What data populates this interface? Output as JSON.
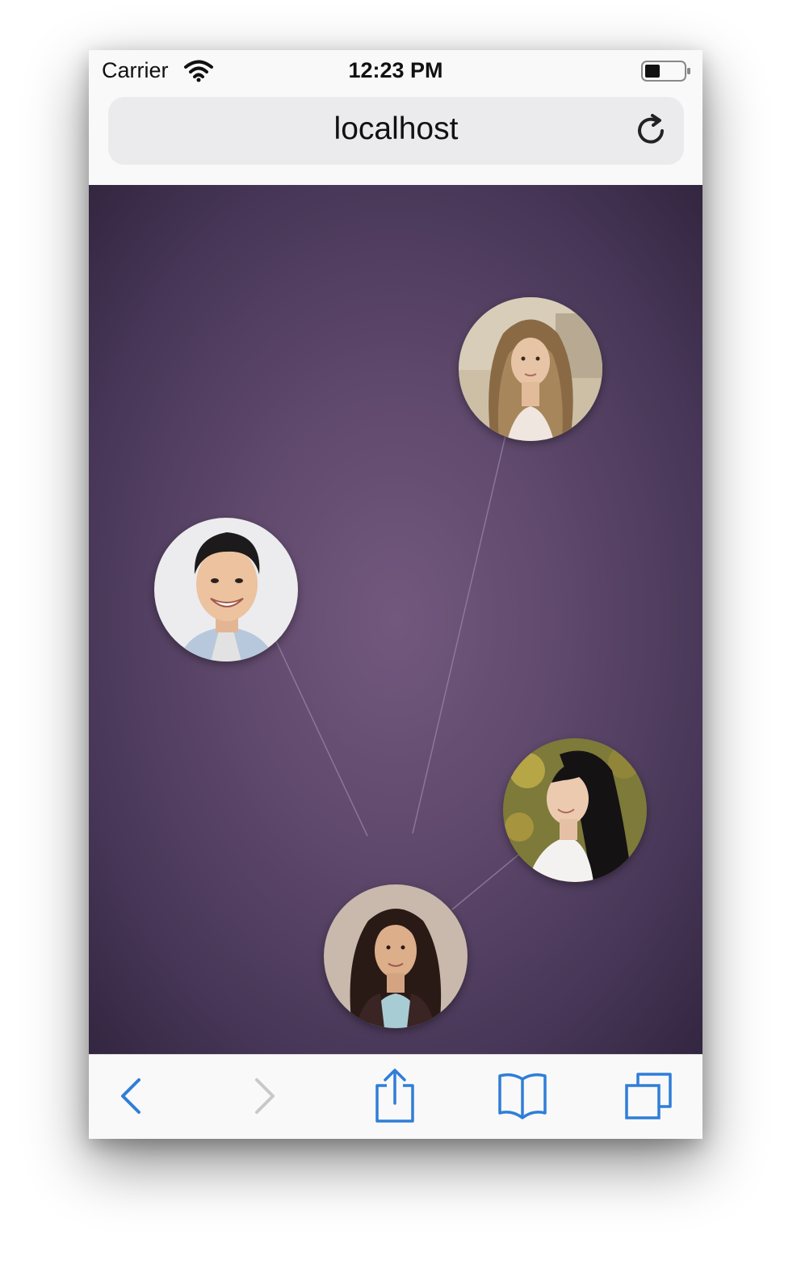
{
  "status_bar": {
    "carrier": "Carrier",
    "time": "12:23 PM",
    "battery_level": 0.4
  },
  "address_bar": {
    "url": "localhost"
  },
  "graph": {
    "nodes": [
      {
        "id": "woman-blonde",
        "icon": "avatar-photo"
      },
      {
        "id": "man-smiling",
        "icon": "avatar-photo"
      },
      {
        "id": "woman-long-black-hair",
        "icon": "avatar-photo"
      },
      {
        "id": "woman-center",
        "icon": "avatar-photo"
      }
    ],
    "edges": [
      {
        "from": "woman-blonde",
        "to": "woman-center"
      },
      {
        "from": "man-smiling",
        "to": "woman-center"
      },
      {
        "from": "woman-long-black-hair",
        "to": "woman-center"
      }
    ]
  },
  "toolbar": {
    "items": [
      {
        "name": "back",
        "icon": "chevron-left-icon",
        "enabled": true
      },
      {
        "name": "forward",
        "icon": "chevron-right-icon",
        "enabled": false
      },
      {
        "name": "share",
        "icon": "share-icon",
        "enabled": true
      },
      {
        "name": "bookmarks",
        "icon": "book-icon",
        "enabled": true
      },
      {
        "name": "tabs",
        "icon": "tabs-icon",
        "enabled": true
      }
    ]
  },
  "colors": {
    "accent": "#2f7ed8",
    "background_center": "#73587e",
    "background_edge": "#332640",
    "link": "#9d88a8"
  }
}
